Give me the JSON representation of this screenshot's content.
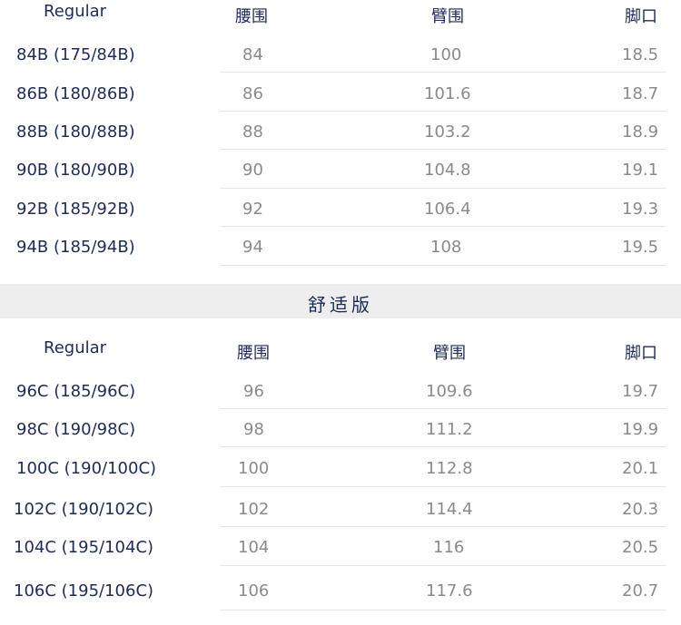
{
  "table1": {
    "headers": [
      "Regular",
      "腰围",
      "臂围",
      "脚口"
    ],
    "rows": [
      [
        "84B (175/84B)",
        "84",
        "100",
        "18.5"
      ],
      [
        "86B (180/86B)",
        "86",
        "101.6",
        "18.7"
      ],
      [
        "88B (180/88B)",
        "88",
        "103.2",
        "18.9"
      ],
      [
        "90B (180/90B)",
        "90",
        "104.8",
        "19.1"
      ],
      [
        "92B (185/92B)",
        "92",
        "106.4",
        "19.3"
      ],
      [
        "94B (185/94B)",
        "94",
        "108",
        "19.5"
      ]
    ]
  },
  "band": {
    "title": "舒适版"
  },
  "table2": {
    "headers": [
      "Regular",
      "腰围",
      "臂围",
      "脚口"
    ],
    "rows": [
      [
        "96C (185/96C)",
        "96",
        "109.6",
        "19.7"
      ],
      [
        "98C (190/98C)",
        "98",
        "111.2",
        "19.9"
      ],
      [
        "100C (190/100C)",
        "100",
        "112.8",
        "20.1"
      ],
      [
        "102C (190/102C)",
        "102",
        "114.4",
        "20.3"
      ],
      [
        "104C (195/104C)",
        "104",
        "116",
        "20.5"
      ],
      [
        "106C (195/106C)",
        "106",
        "117.6",
        "20.7"
      ]
    ]
  }
}
